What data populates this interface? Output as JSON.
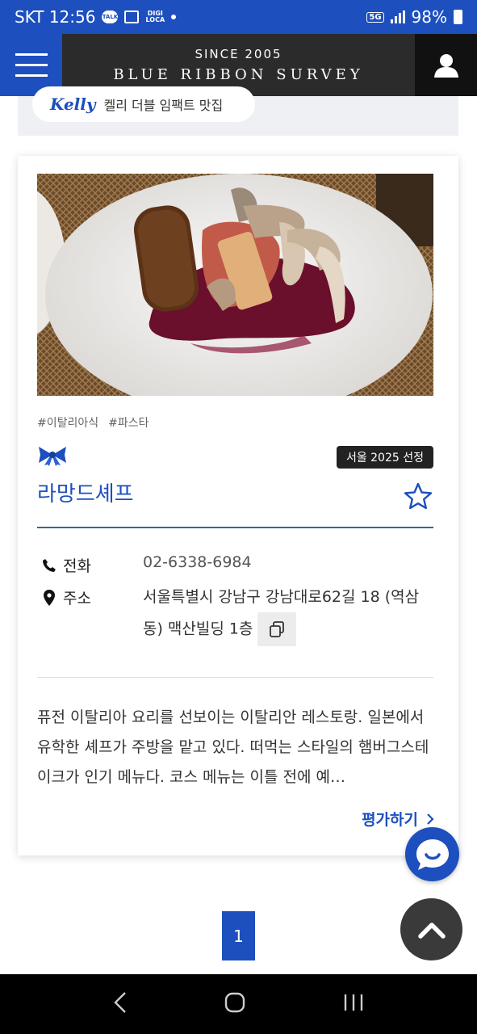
{
  "status_bar": {
    "carrier_time": "SKT 12:56",
    "talk_label": "TALK",
    "digi_label_1": "DIGI",
    "digi_label_2": "LOCA",
    "network": "5G",
    "battery": "98%"
  },
  "header": {
    "since": "SINCE 2005",
    "brand": "BlueRibbonSurvey",
    "brand_display": "BLUE RIBBON SURVEY"
  },
  "promo": {
    "logo": "Kelly",
    "text": "켈리 더블 임팩트 맛집"
  },
  "restaurant": {
    "tags": [
      "#이탈리아식",
      "#파스타"
    ],
    "badge": "서울 2025 선정",
    "name": "라망드셰프",
    "phone_label": "전화",
    "phone": "02-6338-6984",
    "address_label": "주소",
    "address": "서울특별시 강남구 강남대로62길 18 (역삼동) 맥산빌딩 1층",
    "description": "퓨전 이탈리아 요리를 선보이는 이탈리안 레스토랑. 일본에서 유학한 셰프가 주방을 맡고 있다. 떠먹는 스타일의 햄버그스테이크가 인기 메뉴다. 코스 메뉴는 이틀 전에 예…",
    "rate_link": "평가하기"
  },
  "pagination": {
    "current": "1"
  },
  "colors": {
    "brand_blue": "#1d4fbe",
    "header_dark": "#2b2b2b"
  },
  "icons": {
    "menu": "hamburger-icon",
    "user": "user-icon",
    "ribbon": "blue-ribbon-icon",
    "favorite": "star-outline-icon",
    "phone": "phone-icon",
    "location": "map-pin-icon",
    "copy": "copy-icon",
    "chat": "chat-icon",
    "top": "chevron-up-icon"
  }
}
